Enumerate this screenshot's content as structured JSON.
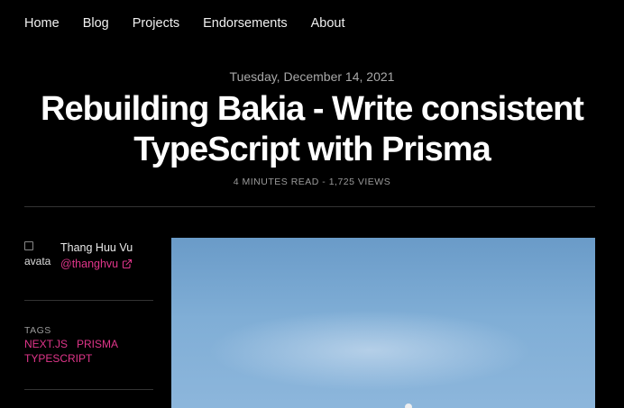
{
  "nav": {
    "items": [
      "Home",
      "Blog",
      "Projects",
      "Endorsements",
      "About"
    ]
  },
  "post": {
    "date": "Tuesday, December 14, 2021",
    "title_line1": "Rebuilding Bakia - Write consistent",
    "title_line2": "TypeScript with Prisma",
    "meta": "4 MINUTES READ - 1,725 VIEWS"
  },
  "author": {
    "avatar_alt": "avata",
    "name": "Thang Huu Vu",
    "handle": "@thanghvu"
  },
  "tags": {
    "label": "TAGS",
    "items": [
      "NEXT.JS",
      "PRISMA",
      "TYPESCRIPT"
    ]
  },
  "colors": {
    "background": "#000000",
    "accent": "#e0358a",
    "muted": "#9a9a9a"
  }
}
